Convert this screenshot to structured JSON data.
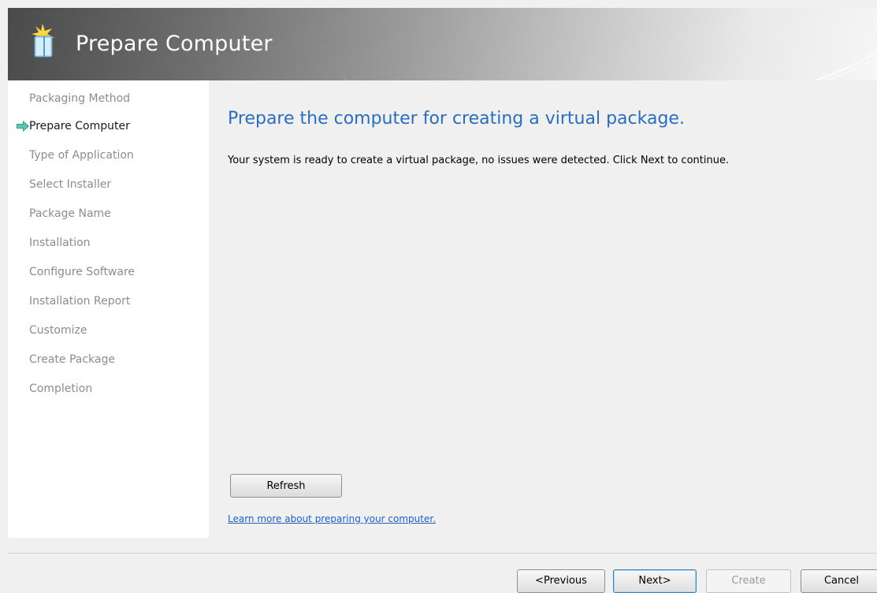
{
  "header": {
    "title": "Prepare Computer"
  },
  "sidebar": {
    "items": [
      {
        "label": "Packaging Method"
      },
      {
        "label": "Prepare Computer"
      },
      {
        "label": "Type of Application"
      },
      {
        "label": "Select Installer"
      },
      {
        "label": "Package Name"
      },
      {
        "label": "Installation"
      },
      {
        "label": "Configure Software"
      },
      {
        "label": "Installation Report"
      },
      {
        "label": "Customize"
      },
      {
        "label": "Create Package"
      },
      {
        "label": "Completion"
      }
    ],
    "active_index": 1,
    "active_icon": "right-arrow-icon"
  },
  "main": {
    "heading": "Prepare the computer for creating a virtual package.",
    "status_text": "Your system is ready to create a virtual package, no issues were detected.  Click Next to continue.",
    "refresh_label": "Refresh",
    "learn_more_link": "Learn more about preparing your computer."
  },
  "footer": {
    "previous_label": "<Previous",
    "next_label": "Next>",
    "create_label": "Create",
    "cancel_label": "Cancel"
  },
  "colors": {
    "heading": "#2a6ebb",
    "link": "#1f5fbf",
    "inactive_step": "#8c8c8c",
    "active_arrow": "#2a9a8a"
  }
}
